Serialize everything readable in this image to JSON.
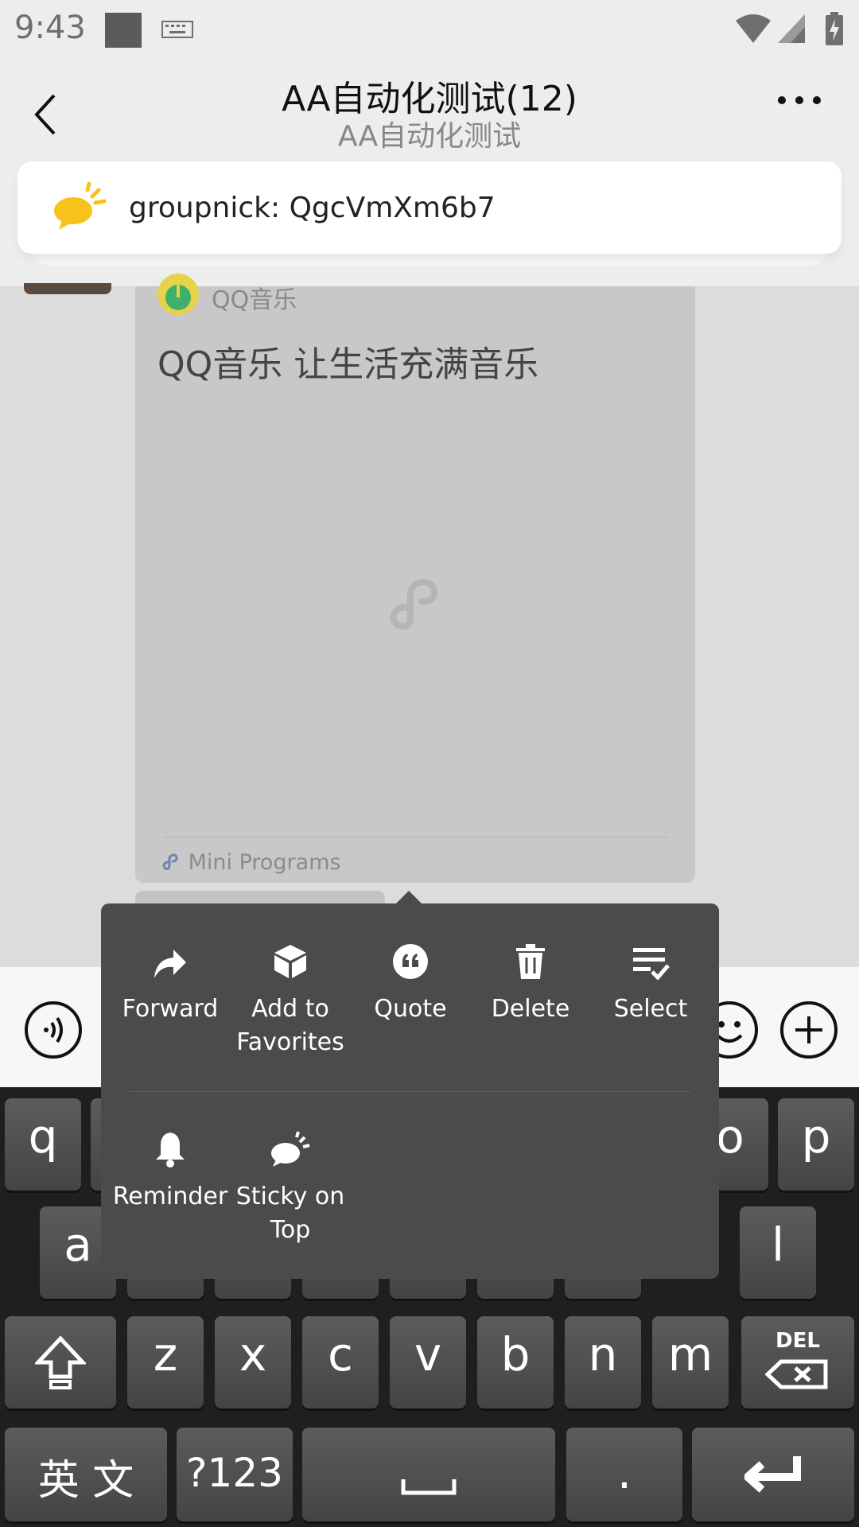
{
  "status_bar": {
    "time": "9:43"
  },
  "header": {
    "title": "AA自动化测试(12)",
    "subtitle": "AA自动化测试"
  },
  "banner": {
    "text": "groupnick: QgcVmXm6b7"
  },
  "message_card": {
    "app_name": "QQ音乐",
    "title": "QQ音乐 让生活充满音乐",
    "footer": "Mini Programs"
  },
  "context_menu": {
    "row1": [
      {
        "label": "Forward",
        "icon": "forward-icon"
      },
      {
        "label": "Add to Favorites",
        "icon": "cube-icon"
      },
      {
        "label": "Quote",
        "icon": "quote-icon"
      },
      {
        "label": "Delete",
        "icon": "trash-icon"
      },
      {
        "label": "Select",
        "icon": "select-list-icon"
      }
    ],
    "row2": [
      {
        "label": "Reminder",
        "icon": "bell-icon"
      },
      {
        "label": "Sticky on Top",
        "icon": "sticky-icon"
      }
    ]
  },
  "keyboard": {
    "row1": [
      "q",
      "o",
      "p"
    ],
    "row2": [
      "a",
      "l"
    ],
    "row3": [
      "z",
      "x",
      "c",
      "v",
      "b",
      "n",
      "m"
    ],
    "del": "DEL",
    "lang": "英 文",
    "sym": "?123",
    "period": "."
  },
  "colors": {
    "menu_bg": "#4b4b4b",
    "banner_icon": "#f7c21b"
  }
}
